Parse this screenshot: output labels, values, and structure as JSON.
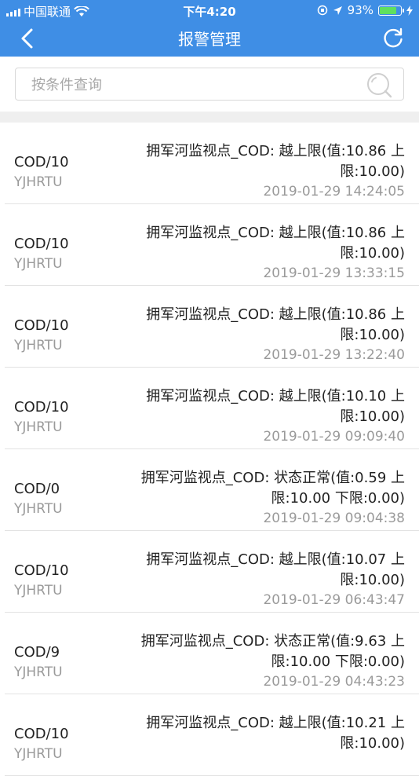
{
  "status_bar": {
    "carrier": "中国联通",
    "time": "下午4:20",
    "battery": "93%",
    "battery_level": 0.93
  },
  "nav": {
    "title": "报警管理"
  },
  "search": {
    "placeholder": "按条件查询",
    "value": ""
  },
  "alarms": [
    {
      "code": "COD/10",
      "device": "YJHRTU",
      "message": "拥军河监视点_COD: 越上限(值:10.86 上限:10.00)",
      "time": "2019-01-29 14:24:05"
    },
    {
      "code": "COD/10",
      "device": "YJHRTU",
      "message": "拥军河监视点_COD: 越上限(值:10.86 上限:10.00)",
      "time": "2019-01-29 13:33:15"
    },
    {
      "code": "COD/10",
      "device": "YJHRTU",
      "message": "拥军河监视点_COD: 越上限(值:10.86 上限:10.00)",
      "time": "2019-01-29 13:22:40"
    },
    {
      "code": "COD/10",
      "device": "YJHRTU",
      "message": "拥军河监视点_COD: 越上限(值:10.10 上限:10.00)",
      "time": "2019-01-29 09:09:40"
    },
    {
      "code": "COD/0",
      "device": "YJHRTU",
      "message": "拥军河监视点_COD: 状态正常(值:0.59 上限:10.00 下限:0.00)",
      "time": "2019-01-29 09:04:38"
    },
    {
      "code": "COD/10",
      "device": "YJHRTU",
      "message": "拥军河监视点_COD: 越上限(值:10.07 上限:10.00)",
      "time": "2019-01-29 06:43:47"
    },
    {
      "code": "COD/9",
      "device": "YJHRTU",
      "message": "拥军河监视点_COD: 状态正常(值:9.63 上限:10.00 下限:0.00)",
      "time": "2019-01-29 04:43:23"
    },
    {
      "code": "COD/10",
      "device": "YJHRTU",
      "message": "拥军河监视点_COD: 越上限(值:10.21 上限:10.00)",
      "time": ""
    }
  ],
  "colors": {
    "header": "#3f8ee5",
    "battery_fill": "#5fe05f"
  }
}
